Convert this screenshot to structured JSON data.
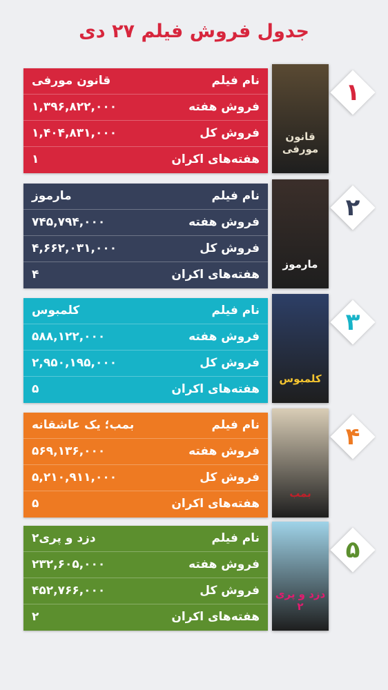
{
  "title": "جدول فروش فیلم ۲۷ دی",
  "labels": {
    "name": "نام فیلم",
    "weekly": "فروش هفته",
    "total": "فروش کل",
    "weeks": "هفته‌های اکران"
  },
  "films": [
    {
      "rank": "۱",
      "name": "قانون مورفی",
      "weekly": "۱,۳۹۶,۸۲۲,۰۰۰",
      "total": "۱,۴۰۴,۸۳۱,۰۰۰",
      "weeks": "۱",
      "color": "#d7263d",
      "poster_title": "قانون مورفی",
      "poster_bg": "#5a4a33",
      "poster_fg": "#e9e2cf"
    },
    {
      "rank": "۲",
      "name": "مارموز",
      "weekly": "۷۴۵,۷۹۴,۰۰۰",
      "total": "۴,۶۶۲,۰۳۱,۰۰۰",
      "weeks": "۴",
      "color": "#36405a",
      "poster_title": "مارموز",
      "poster_bg": "#3b2f2a",
      "poster_fg": "#ffffff"
    },
    {
      "rank": "۳",
      "name": "کلمبوس",
      "weekly": "۵۸۸,۱۲۲,۰۰۰",
      "total": "۲,۹۵۰,۱۹۵,۰۰۰",
      "weeks": "۵",
      "color": "#17b3c8",
      "poster_title": "کلمبوس",
      "poster_bg": "#2d3f67",
      "poster_fg": "#f4c430"
    },
    {
      "rank": "۴",
      "name": "بمب؛ یک عاشقانه",
      "weekly": "۵۶۹,۱۳۶,۰۰۰",
      "total": "۵,۲۱۰,۹۱۱,۰۰۰",
      "weeks": "۵",
      "color": "#ee7a22",
      "poster_title": "بمب",
      "poster_bg": "#d9cdb6",
      "poster_fg": "#c0202a"
    },
    {
      "rank": "۵",
      "name": "دزد و پری۲",
      "weekly": "۲۳۲,۶۰۵,۰۰۰",
      "total": "۴۵۲,۷۶۶,۰۰۰",
      "weeks": "۲",
      "color": "#5c8f2e",
      "poster_title": "دزد و پری ۲",
      "poster_bg": "#9fd3e8",
      "poster_fg": "#e21c6f"
    }
  ]
}
